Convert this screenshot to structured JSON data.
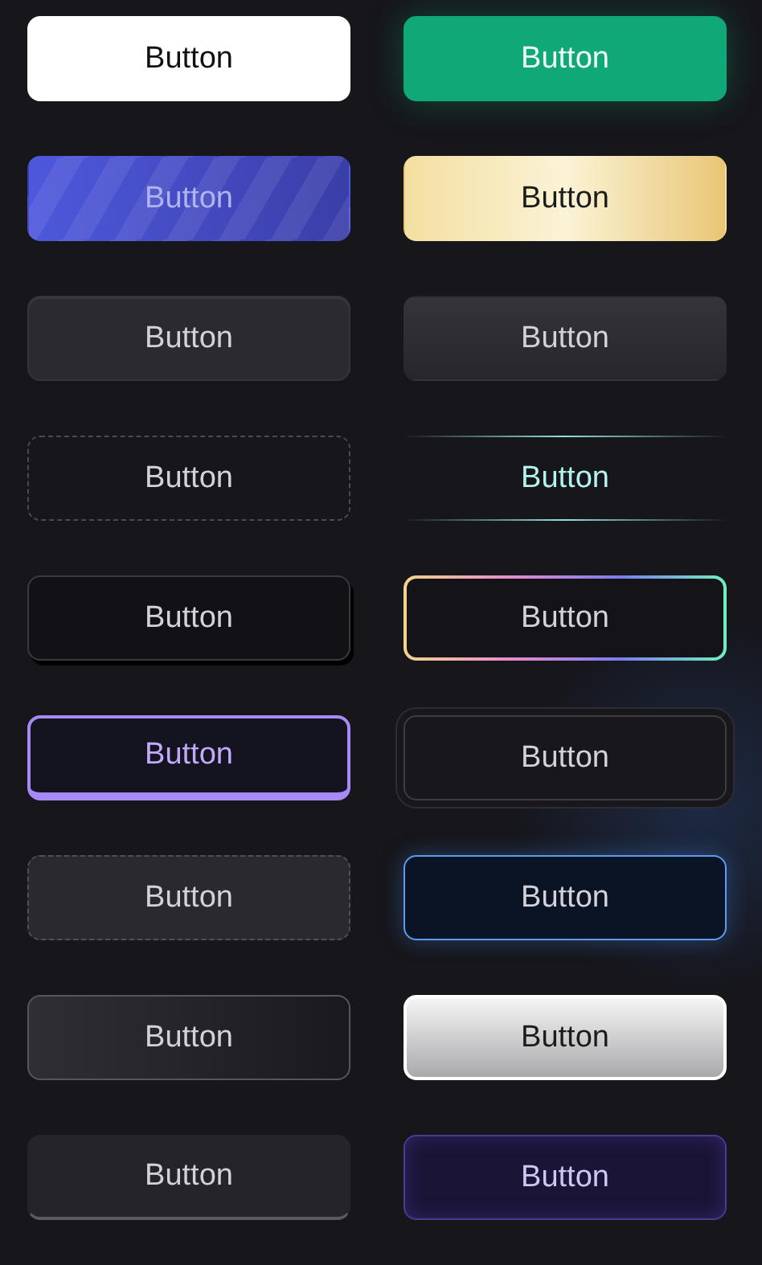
{
  "buttons": [
    {
      "label": "Button",
      "kind": "white"
    },
    {
      "label": "Button",
      "kind": "green"
    },
    {
      "label": "Button",
      "kind": "striped"
    },
    {
      "label": "Button",
      "kind": "gold"
    },
    {
      "label": "Button",
      "kind": "dark"
    },
    {
      "label": "Button",
      "kind": "darkgrad"
    },
    {
      "label": "Button",
      "kind": "dashed"
    },
    {
      "label": "Button",
      "kind": "lines"
    },
    {
      "label": "Button",
      "kind": "outlined"
    },
    {
      "label": "Button",
      "kind": "rainbow"
    },
    {
      "label": "Button",
      "kind": "purple"
    },
    {
      "label": "Button",
      "kind": "ring"
    },
    {
      "label": "Button",
      "kind": "dashedfill"
    },
    {
      "label": "Button",
      "kind": "blueglow"
    },
    {
      "label": "Button",
      "kind": "gradborder"
    },
    {
      "label": "Button",
      "kind": "silver"
    },
    {
      "label": "Button",
      "kind": "underline"
    },
    {
      "label": "Button",
      "kind": "violet"
    }
  ]
}
